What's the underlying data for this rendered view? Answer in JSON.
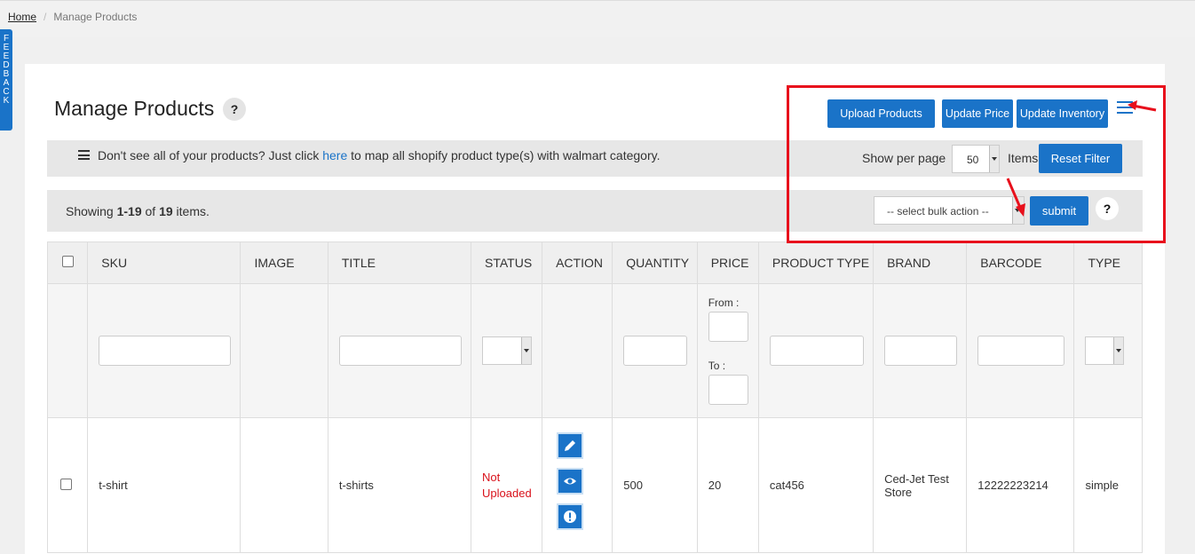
{
  "breadcrumb": {
    "home": "Home",
    "current": "Manage Products"
  },
  "feedback": {
    "letters": [
      "F",
      "E",
      "E",
      "D",
      "B",
      "A",
      "C",
      "K"
    ]
  },
  "header": {
    "title": "Manage Products",
    "help": "?"
  },
  "toolbar": {
    "upload_products": "Upload Products",
    "update_price": "Update Price",
    "update_inventory": "Update Inventory"
  },
  "info": {
    "text_before": "Don't see all of your products? Just click ",
    "link": "here",
    "text_after": " to map all shopify product type(s) with walmart category."
  },
  "paging": {
    "show_per_page": "Show per page",
    "per_page_value": "50",
    "items_label": "Items",
    "reset_filter": "Reset Filter"
  },
  "summary": {
    "prefix": "Showing ",
    "range": "1-19",
    "of": " of ",
    "total": "19",
    "suffix": " items."
  },
  "bulk": {
    "placeholder": "-- select bulk action --",
    "submit": "submit",
    "help": "?"
  },
  "table": {
    "columns": [
      "SKU",
      "IMAGE",
      "TITLE",
      "STATUS",
      "ACTION",
      "QUANTITY",
      "PRICE",
      "PRODUCT TYPE",
      "BRAND",
      "BARCODE",
      "TYPE"
    ],
    "price_filter": {
      "from": "From :",
      "to": "To :"
    },
    "rows": [
      {
        "sku": "t-shirt",
        "image": "",
        "title": "t-shirts",
        "status_line1": "Not",
        "status_line2": "Uploaded",
        "quantity": "500",
        "price": "20",
        "product_type": "cat456",
        "brand_line1": "Ced-Jet Test",
        "brand_line2": "Store",
        "barcode": "12222223214",
        "type": "simple"
      }
    ]
  },
  "colors": {
    "primary": "#1a73c8",
    "highlight": "#e8101c",
    "status_error": "#d9121b"
  },
  "icons": [
    "hamburger-icon",
    "list-icon",
    "edit-icon",
    "view-icon",
    "alert-icon",
    "arrow-annotation-icon"
  ]
}
